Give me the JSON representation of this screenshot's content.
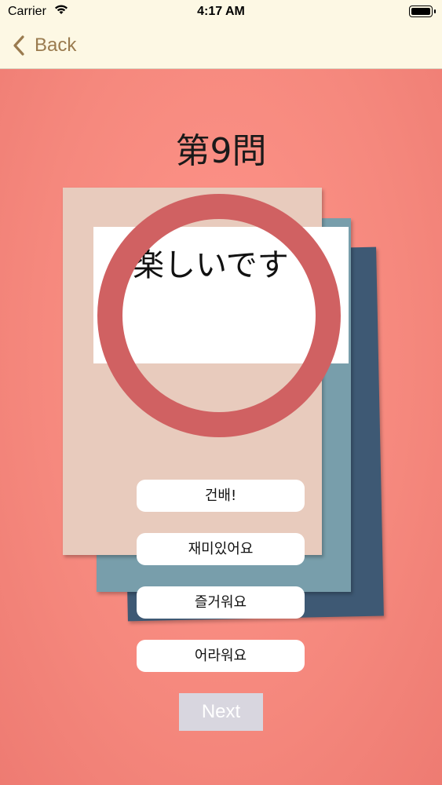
{
  "status_bar": {
    "carrier": "Carrier",
    "time": "4:17 AM"
  },
  "nav": {
    "back_label": "Back"
  },
  "quiz": {
    "title": "第9問",
    "question": "楽しいです",
    "answers": [
      {
        "label": "건배!"
      },
      {
        "label": "재미있어요"
      },
      {
        "label": "즐거워요"
      },
      {
        "label": "어라워요"
      }
    ],
    "next_label": "Next",
    "next_enabled": false
  },
  "colors": {
    "nav_bg": "#fdf8e4",
    "accent": "#9a7b4f",
    "background": "#f58a80",
    "ring": "#d06162",
    "next_disabled": "#d8d6df"
  }
}
